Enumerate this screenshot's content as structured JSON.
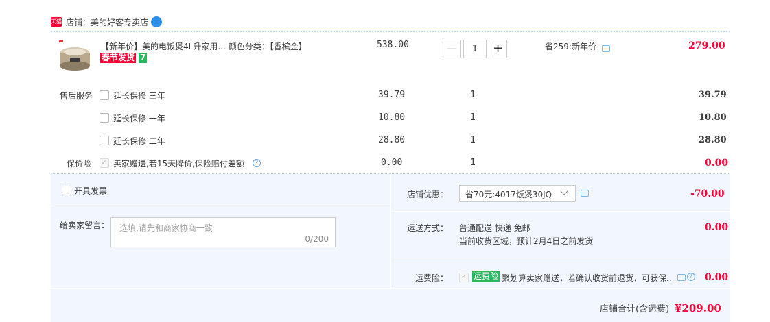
{
  "shop": {
    "label": "店铺：美的好客专卖店",
    "tmall_logo": "天猫"
  },
  "item": {
    "title": "【新年价】美的电饭煲4L升家用...",
    "sku_label": "颜色分类：【香槟金】",
    "festival_badge": "春节发货",
    "badge_7": "7",
    "unit_price": "538.00",
    "qty": "1",
    "qty_minus": "—",
    "qty_plus": "+",
    "discount_text": "省259:新年价",
    "total": "279.00"
  },
  "services": {
    "label": "售后服务",
    "rows": [
      {
        "name": "延长保修 三年",
        "price": "39.79",
        "qty": "1",
        "total": "39.79"
      },
      {
        "name": "延长保修 一年",
        "price": "10.80",
        "qty": "1",
        "total": "10.80"
      },
      {
        "name": "延长保修 二年",
        "price": "28.80",
        "qty": "1",
        "total": "28.80"
      }
    ],
    "insurance": {
      "label": "保价险",
      "name": "卖家赠送,若15天降价,保险赔付差额",
      "price": "0.00",
      "qty": "1",
      "total": "0.00"
    }
  },
  "invoice": {
    "label": "开具发票"
  },
  "message": {
    "label": "给卖家留言：",
    "placeholder": "选填,请先和商家协商一致",
    "counter": "0/200"
  },
  "shop_coupon": {
    "label": "店铺优惠：",
    "selected": "省70元:4017饭煲30JQ",
    "amount": "-70.00"
  },
  "shipping": {
    "label": "运送方式：",
    "method": "普通配送 快递 免邮",
    "note": "当前收货区域，预计2月4日之前发货",
    "amount": "0.00"
  },
  "freight_ins": {
    "label": "运费险：",
    "badge": "运费险",
    "text": "聚划算卖家赠送，若确认收货前退货，可获保..",
    "amount": "0.00"
  },
  "summary": {
    "label": "店铺合计(含运费)",
    "total": "¥209.00"
  },
  "icons": {
    "shop": "shop-badge-icon",
    "message": "message-icon",
    "help": "question-icon",
    "dropdown": "chevron-down-icon"
  },
  "colors": {
    "accent_red": "#ff0036",
    "panel_bg": "#f2f7ff",
    "divider": "#b2d1ff",
    "badge_green": "#2ab760"
  }
}
